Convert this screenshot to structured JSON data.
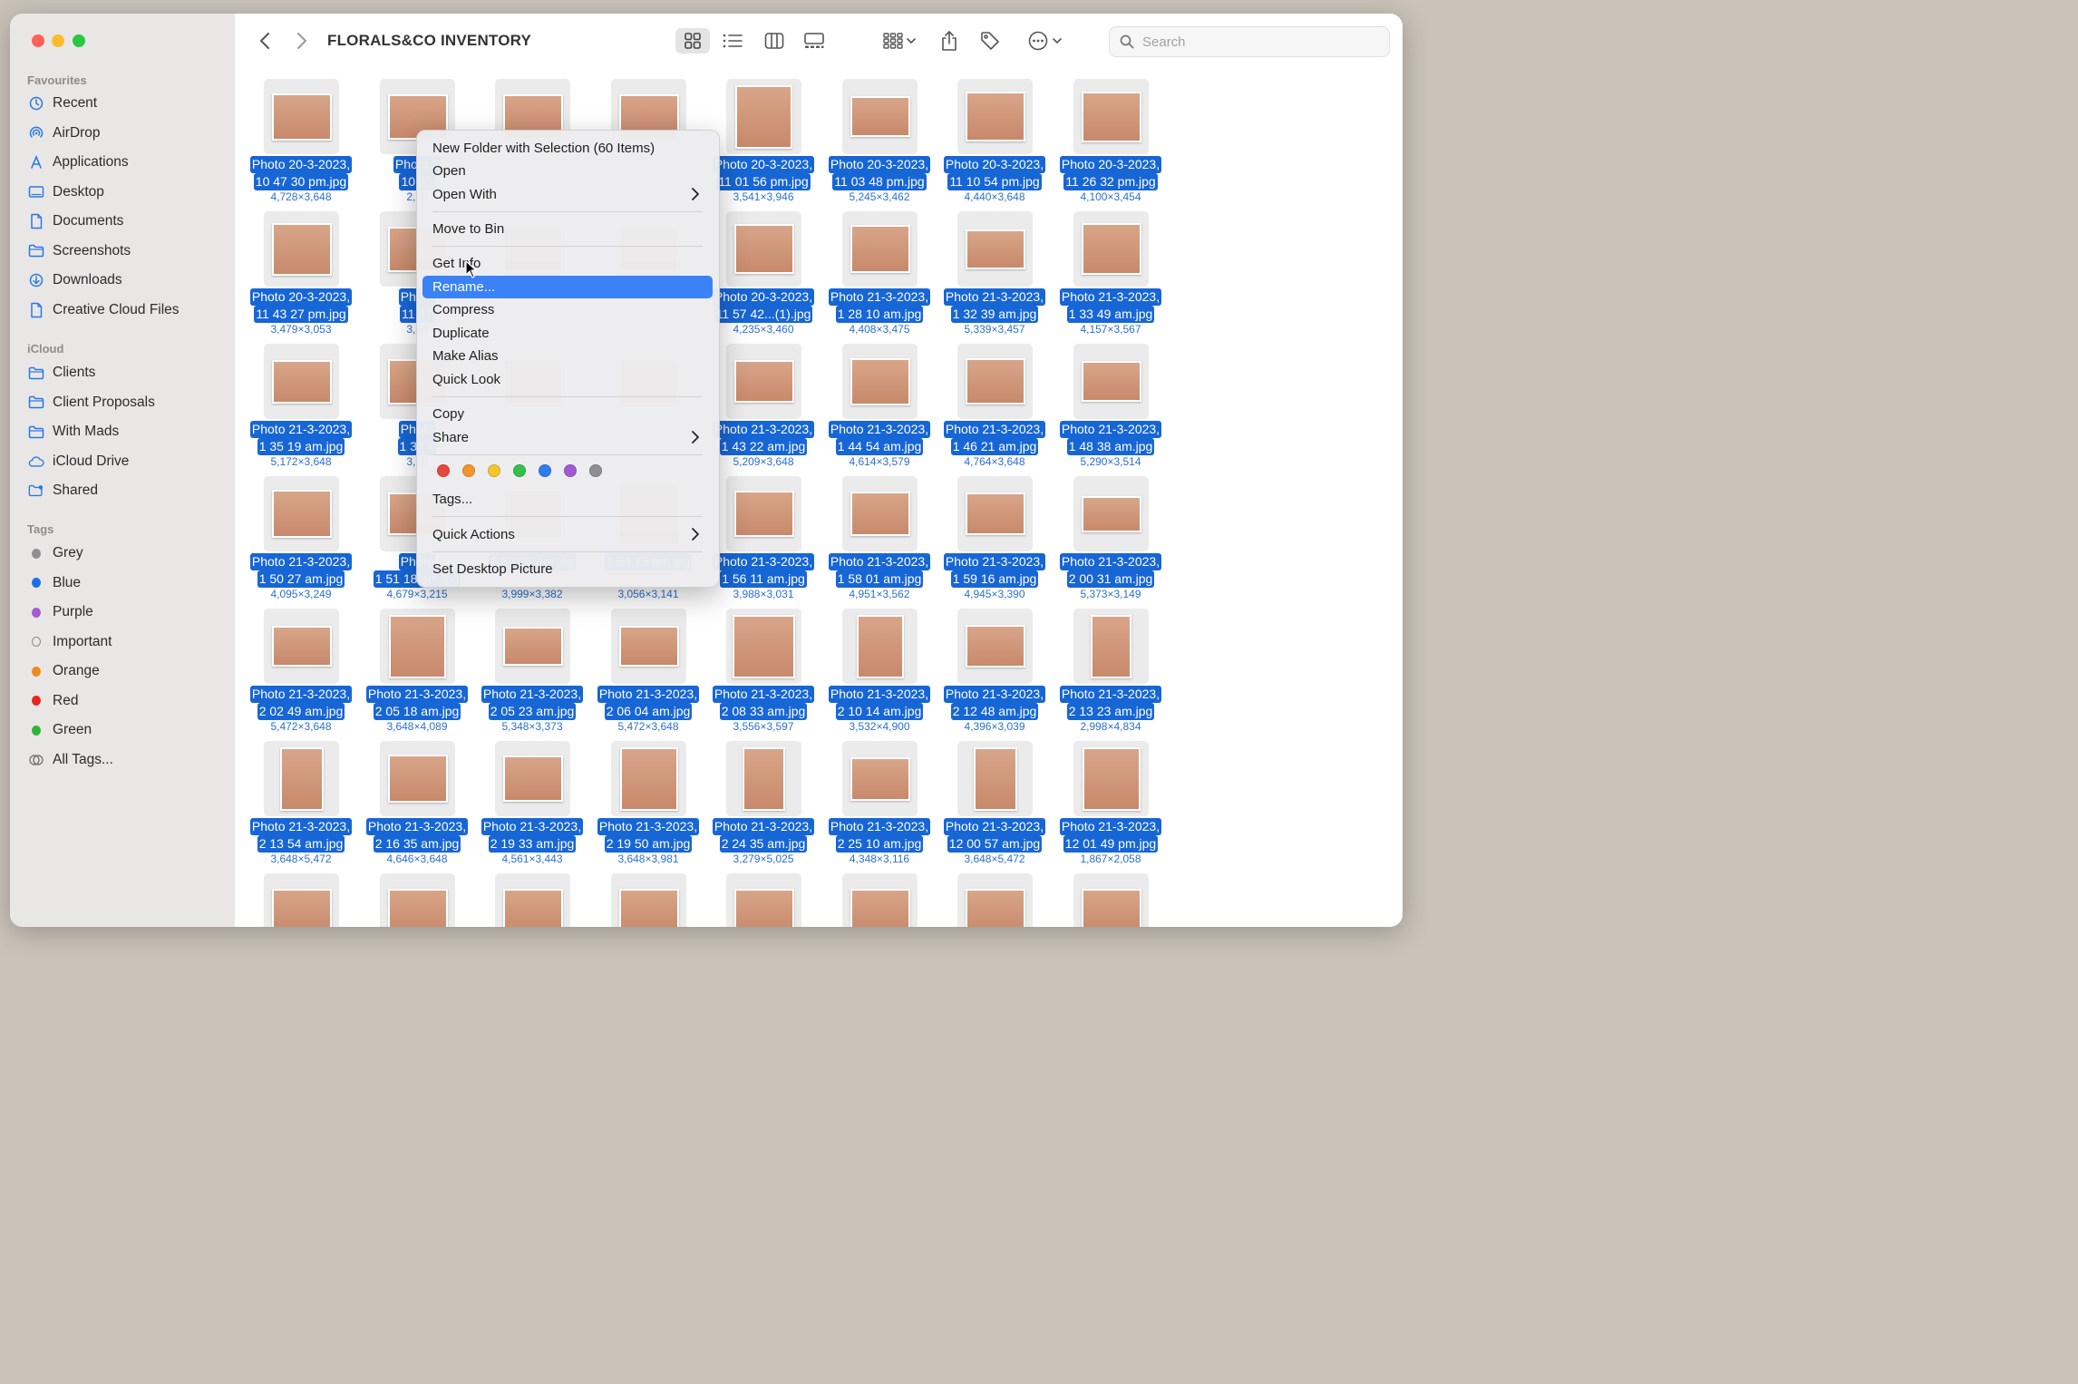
{
  "window": {
    "title": "FLORALS&CO INVENTORY"
  },
  "toolbar": {
    "search_placeholder": "Search"
  },
  "sidebar": {
    "favourites_header": "Favourites",
    "favourites": [
      {
        "label": "Recent",
        "icon": "clock-icon"
      },
      {
        "label": "AirDrop",
        "icon": "airdrop-icon"
      },
      {
        "label": "Applications",
        "icon": "applications-icon"
      },
      {
        "label": "Desktop",
        "icon": "desktop-icon"
      },
      {
        "label": "Documents",
        "icon": "document-icon"
      },
      {
        "label": "Screenshots",
        "icon": "folder-icon"
      },
      {
        "label": "Downloads",
        "icon": "download-icon"
      },
      {
        "label": "Creative Cloud Files",
        "icon": "document-icon"
      }
    ],
    "icloud_header": "iCloud",
    "icloud": [
      {
        "label": "Clients",
        "icon": "folder-icon"
      },
      {
        "label": "Client Proposals",
        "icon": "folder-icon"
      },
      {
        "label": "With Mads",
        "icon": "folder-icon"
      },
      {
        "label": "iCloud Drive",
        "icon": "cloud-icon"
      },
      {
        "label": "Shared",
        "icon": "shared-folder-icon"
      }
    ],
    "tags_header": "Tags",
    "tags": [
      {
        "label": "Grey",
        "color": "#8e8e93"
      },
      {
        "label": "Blue",
        "color": "#1f6ee8"
      },
      {
        "label": "Purple",
        "color": "#a55bd1"
      },
      {
        "label": "Important",
        "color": "none"
      },
      {
        "label": "Orange",
        "color": "#f08a1c"
      },
      {
        "label": "Red",
        "color": "#e8251f"
      },
      {
        "label": "Green",
        "color": "#2fb43a"
      },
      {
        "label": "All Tags...",
        "color": "all"
      }
    ]
  },
  "files": [
    {
      "l1": "Photo 20-3-2023,",
      "l2": "10 47 30 pm.jpg",
      "dims": "4,728×3,648"
    },
    {
      "l1": "Photo 2",
      "l2": "10 55",
      "dims": "2,78"
    },
    {
      "l1": "",
      "l2": "",
      "dims": ""
    },
    {
      "l1": "",
      "l2": "",
      "dims": ""
    },
    {
      "l1": "Photo 20-3-2023,",
      "l2": "11 01 56 pm.jpg",
      "dims": "3,541×3,946"
    },
    {
      "l1": "Photo 20-3-2023,",
      "l2": "11 03 48 pm.jpg",
      "dims": "5,245×3,462"
    },
    {
      "l1": "Photo 20-3-2023,",
      "l2": "11 10 54 pm.jpg",
      "dims": "4,440×3,648"
    },
    {
      "l1": "Photo 20-3-2023,",
      "l2": "11 26 32 pm.jpg",
      "dims": "4,100×3,454"
    },
    {
      "l1": "Photo 20-3-2023,",
      "l2": "11 43 27 pm.jpg",
      "dims": "3,479×3,053"
    },
    {
      "l1": "Photo",
      "l2": "11 47",
      "dims": "3,60"
    },
    {
      "l1": "",
      "l2": "",
      "dims": ""
    },
    {
      "l1": "",
      "l2": "",
      "dims": ""
    },
    {
      "l1": "Photo 20-3-2023,",
      "l2": "11 57 42...(1).jpg",
      "dims": "4,235×3,460"
    },
    {
      "l1": "Photo 21-3-2023,",
      "l2": "1 28 10 am.jpg",
      "dims": "4,408×3,475"
    },
    {
      "l1": "Photo 21-3-2023,",
      "l2": "1 32 39 am.jpg",
      "dims": "5,339×3,457"
    },
    {
      "l1": "Photo 21-3-2023,",
      "l2": "1 33 49 am.jpg",
      "dims": "4,157×3,567"
    },
    {
      "l1": "Photo 21-3-2023,",
      "l2": "1 35 19 am.jpg",
      "dims": "5,172×3,648"
    },
    {
      "l1": "Photo",
      "l2": "1 37 4",
      "dims": "3,78"
    },
    {
      "l1": "",
      "l2": "",
      "dims": ""
    },
    {
      "l1": "",
      "l2": "",
      "dims": ""
    },
    {
      "l1": "Photo 21-3-2023,",
      "l2": "1 43 22 am.jpg",
      "dims": "5,209×3,648"
    },
    {
      "l1": "Photo 21-3-2023,",
      "l2": "1 44 54 am.jpg",
      "dims": "4,614×3,579"
    },
    {
      "l1": "Photo 21-3-2023,",
      "l2": "1 46 21 am.jpg",
      "dims": "4,764×3,648"
    },
    {
      "l1": "Photo 21-3-2023,",
      "l2": "1 48 38 am.jpg",
      "dims": "5,290×3,514"
    },
    {
      "l1": "Photo 21-3-2023,",
      "l2": "1 50 27 am.jpg",
      "dims": "4,095×3,249"
    },
    {
      "l1": "Photo",
      "l2": "1 51 18 am.jpg",
      "dims": "4,679×3,215"
    },
    {
      "l1": "",
      "l2": "1 52 26 am.jpg",
      "dims": "3,999×3,382"
    },
    {
      "l1": "",
      "l2": "1 54 15 am.jpg",
      "dims": "3,056×3,141"
    },
    {
      "l1": "Photo 21-3-2023,",
      "l2": "1 56 11 am.jpg",
      "dims": "3,988×3,031"
    },
    {
      "l1": "Photo 21-3-2023,",
      "l2": "1 58 01 am.jpg",
      "dims": "4,951×3,562"
    },
    {
      "l1": "Photo 21-3-2023,",
      "l2": "1 59 16 am.jpg",
      "dims": "4,945×3,390"
    },
    {
      "l1": "Photo 21-3-2023,",
      "l2": "2 00 31 am.jpg",
      "dims": "5,373×3,149"
    },
    {
      "l1": "Photo 21-3-2023,",
      "l2": "2 02 49 am.jpg",
      "dims": "5,472×3,648"
    },
    {
      "l1": "Photo 21-3-2023,",
      "l2": "2 05 18 am.jpg",
      "dims": "3,648×4,089"
    },
    {
      "l1": "Photo 21-3-2023,",
      "l2": "2 05 23 am.jpg",
      "dims": "5,348×3,373"
    },
    {
      "l1": "Photo 21-3-2023,",
      "l2": "2 06 04 am.jpg",
      "dims": "5,472×3,648"
    },
    {
      "l1": "Photo 21-3-2023,",
      "l2": "2 08 33 am.jpg",
      "dims": "3,556×3,597"
    },
    {
      "l1": "Photo 21-3-2023,",
      "l2": "2 10 14 am.jpg",
      "dims": "3,532×4,900"
    },
    {
      "l1": "Photo 21-3-2023,",
      "l2": "2 12 48 am.jpg",
      "dims": "4,396×3,039"
    },
    {
      "l1": "Photo 21-3-2023,",
      "l2": "2 13 23 am.jpg",
      "dims": "2,998×4,834"
    },
    {
      "l1": "Photo 21-3-2023,",
      "l2": "2 13 54 am.jpg",
      "dims": "3,648×5,472"
    },
    {
      "l1": "Photo 21-3-2023,",
      "l2": "2 16 35 am.jpg",
      "dims": "4,646×3,648"
    },
    {
      "l1": "Photo 21-3-2023,",
      "l2": "2 19 33 am.jpg",
      "dims": "4,561×3,443"
    },
    {
      "l1": "Photo 21-3-2023,",
      "l2": "2 19 50 am.jpg",
      "dims": "3,648×3,981"
    },
    {
      "l1": "Photo 21-3-2023,",
      "l2": "2 24 35 am.jpg",
      "dims": "3,279×5,025"
    },
    {
      "l1": "Photo 21-3-2023,",
      "l2": "2 25 10 am.jpg",
      "dims": "4,348×3,116"
    },
    {
      "l1": "Photo 21-3-2023,",
      "l2": "12 00 57 am.jpg",
      "dims": "3,648×5,472"
    },
    {
      "l1": "Photo 21-3-2023,",
      "l2": "12 01 49 pm.jpg",
      "dims": "1,867×2,058"
    },
    {
      "l1": "",
      "l2": "",
      "dims": ""
    },
    {
      "l1": "",
      "l2": "",
      "dims": ""
    },
    {
      "l1": "",
      "l2": "",
      "dims": ""
    },
    {
      "l1": "",
      "l2": "",
      "dims": ""
    },
    {
      "l1": "",
      "l2": "",
      "dims": ""
    },
    {
      "l1": "",
      "l2": "",
      "dims": ""
    },
    {
      "l1": "",
      "l2": "",
      "dims": ""
    },
    {
      "l1": "",
      "l2": "",
      "dims": ""
    }
  ],
  "context_menu": {
    "new_folder": "New Folder with Selection (60 Items)",
    "open": "Open",
    "open_with": "Open With",
    "move_to_bin": "Move to Bin",
    "get_info": "Get Info",
    "rename": "Rename...",
    "compress": "Compress",
    "duplicate": "Duplicate",
    "make_alias": "Make Alias",
    "quick_look": "Quick Look",
    "copy": "Copy",
    "share": "Share",
    "tag_colors": [
      "#e8473f",
      "#f4962b",
      "#f6c431",
      "#35c04a",
      "#2f7df0",
      "#a359d6",
      "#8f8f93"
    ],
    "tags": "Tags...",
    "quick_actions": "Quick Actions",
    "set_desktop_picture": "Set Desktop Picture"
  }
}
